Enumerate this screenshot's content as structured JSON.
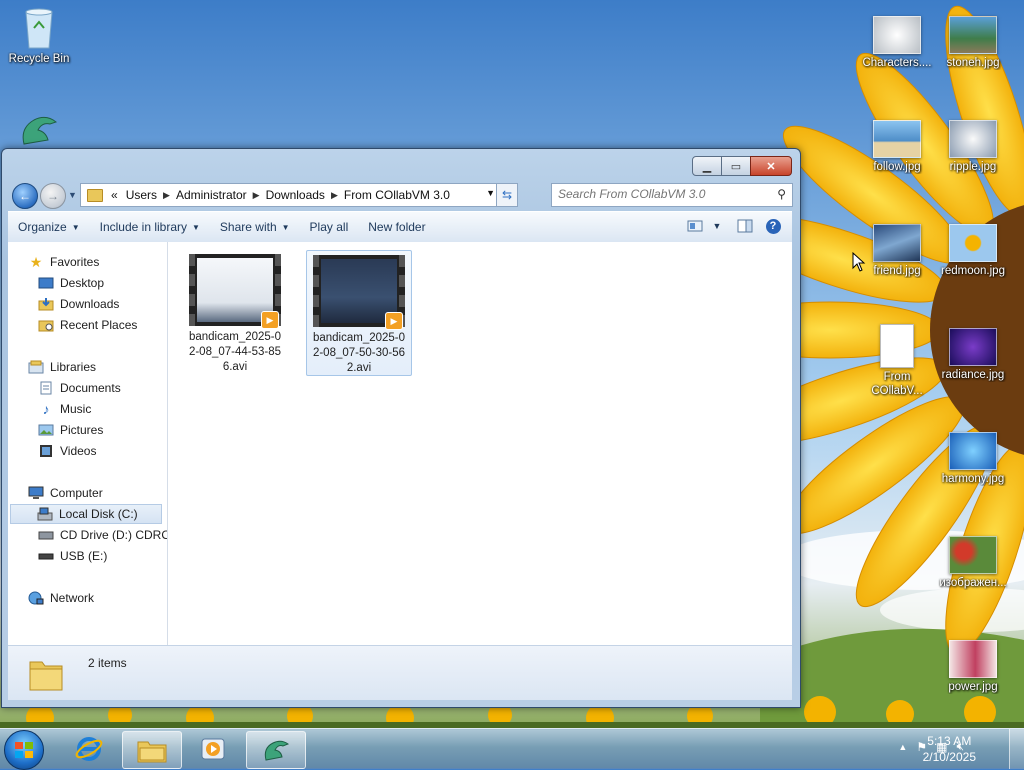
{
  "desktop": {
    "icons": [
      {
        "label": "Recycle Bin"
      },
      {
        "label": "Characters...."
      },
      {
        "label": "stoneh.jpg"
      },
      {
        "label": "follow.jpg"
      },
      {
        "label": "ripple.jpg"
      },
      {
        "label": "friend.jpg"
      },
      {
        "label": "redmoon.jpg"
      },
      {
        "label": "From COllabV..."
      },
      {
        "label": "radiance.jpg"
      },
      {
        "label": "harmony.jpg"
      },
      {
        "label": "изображен..."
      },
      {
        "label": "power.jpg"
      }
    ]
  },
  "window": {
    "address": {
      "overflow": "«",
      "crumbs": [
        "Users",
        "Administrator",
        "Downloads",
        "From COllabVM 3.0"
      ]
    },
    "search_placeholder": "Search From COllabVM 3.0",
    "toolbar": {
      "organize": "Organize",
      "include_in_library": "Include in library",
      "share_with": "Share with",
      "play_all": "Play all",
      "new_folder": "New folder"
    },
    "nav": {
      "favorites": "Favorites",
      "desktop": "Desktop",
      "downloads": "Downloads",
      "recent_places": "Recent Places",
      "libraries": "Libraries",
      "documents": "Documents",
      "music": "Music",
      "pictures": "Pictures",
      "videos": "Videos",
      "computer": "Computer",
      "local_disk": "Local Disk (C:)",
      "cd_drive": "CD Drive (D:) CDROM",
      "usb": "USB (E:)",
      "network": "Network"
    },
    "files": [
      {
        "name": "bandicam_2025-02-08_07-44-53-856.avi"
      },
      {
        "name": "bandicam_2025-02-08_07-50-30-562.avi"
      }
    ],
    "status": "2 items"
  },
  "taskbar": {
    "time": "5:13 AM",
    "date": "2/10/2025"
  },
  "colors": {
    "accent": "#2d6fc2",
    "window_frame": "#b8cee6",
    "close_button": "#c8442b"
  }
}
